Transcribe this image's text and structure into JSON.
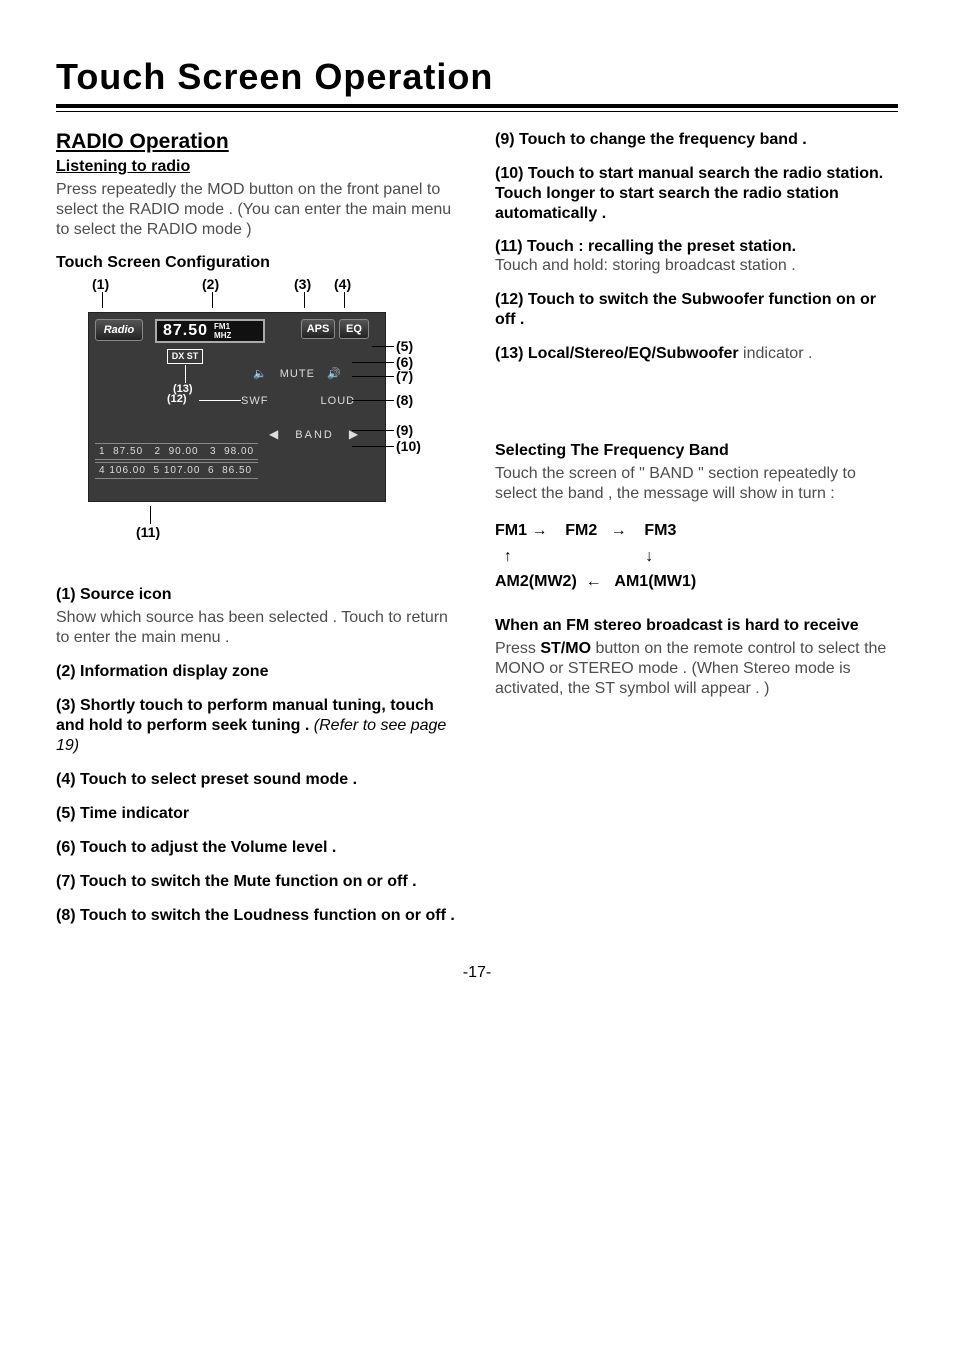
{
  "title": "Touch Screen Operation",
  "page_number": "-17-",
  "left": {
    "h2": "RADIO Operation",
    "h3_listen": "Listening to radio",
    "p_listen": "Press repeatedly the MOD button on the front panel to select the RADIO mode . (You can enter the main menu to select the RADIO mode )",
    "h3_config": "Touch Screen Configuration",
    "labels_top": {
      "l1": "(1)",
      "l2": "(2)",
      "l3": "(3)",
      "l4": "(4)"
    },
    "screen": {
      "radio": "Radio",
      "freq": "87.50",
      "band_small": "FM1",
      "mhz": "MHZ",
      "aps": "APS",
      "eq": "EQ",
      "dxst": "DX ST",
      "mute": "MUTE",
      "swf": "SWF",
      "loud": "LOUD",
      "band": "BAND",
      "presets_row1": "1  87.50   2  90.00   3  98.00",
      "presets_row2": "4 106.00  5 107.00  6  86.50",
      "label13": "(13)",
      "label12": "(12)"
    },
    "labels_right": {
      "l5": "(5)",
      "l6": "(6)",
      "l7": "(7)",
      "l8": "(8)",
      "l9": "(9)",
      "l10": "(10)"
    },
    "label11": "(11)",
    "i1_h": "(1) Source icon",
    "i1_p": "Show which source has been selected . Touch to return to enter the main menu .",
    "i2": "(2) Information display zone",
    "i3_a": "(3) Shortly touch to perform manual tuning, touch and hold to perform seek tuning . ",
    "i3_b": "(Refer to see page 19)",
    "i4": "(4) Touch to select preset sound mode .",
    "i5": "(5) Time indicator",
    "i6": "(6) Touch to adjust the Volume level .",
    "i7": "(7) Touch to switch the Mute function on or off .",
    "i8": "(8) Touch to switch the Loudness function on or off ."
  },
  "right": {
    "i9": "(9) Touch to change the frequency band .",
    "i10": "(10) Touch to start manual search the  radio station. Touch longer to start  search the radio station automatically .",
    "i11_b": "(11) Touch : recalling the preset station.",
    "i11_p": " Touch and hold: storing broadcast station .",
    "i12": "(12) Touch to switch the Subwoofer  function on or off .",
    "i13_b": "(13) Local/Stereo/EQ/Subwoofer",
    "i13_p": " indicator .",
    "h_band": "Selecting The Frequency Band",
    "p_band": "Touch the screen of \" BAND \" section repeatedly to select the band , the message will show in turn :",
    "cycle": {
      "fm1": "FM1",
      "fm2": "FM2",
      "fm3": "FM3",
      "am2": "AM2(MW2)",
      "am1": "AM1(MW1)"
    },
    "h_stereo": "When an FM stereo broadcast is hard to receive",
    "p_stereo_a": "Press ",
    "p_stereo_b": "ST/MO",
    "p_stereo_c": " button on the remote control to select the MONO or STEREO mode . (When Stereo mode is activated, the ST symbol will appear . )"
  }
}
